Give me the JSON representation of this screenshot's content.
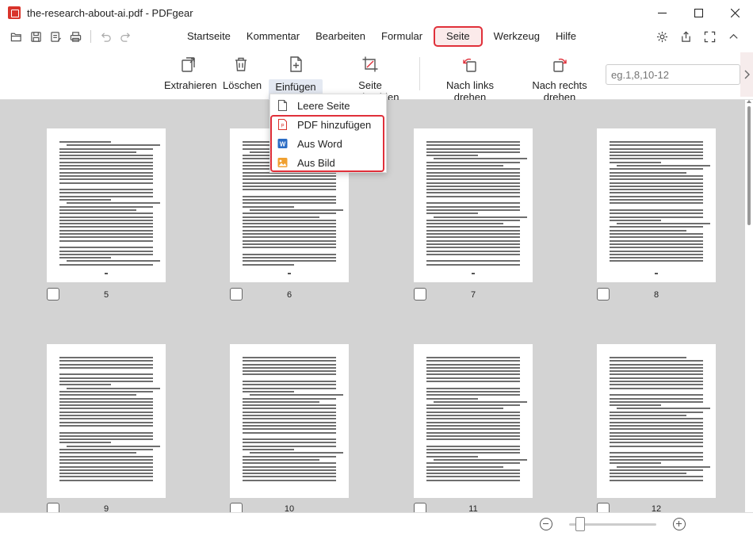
{
  "window": {
    "title": "the-research-about-ai.pdf - PDFgear"
  },
  "menu": {
    "items": [
      "Startseite",
      "Kommentar",
      "Bearbeiten",
      "Formular",
      "Seite",
      "Werkzeug",
      "Hilfe"
    ],
    "active": "Seite"
  },
  "toolbar": {
    "extract": "Extrahieren",
    "delete": "Löschen",
    "insert": "Einfügen",
    "crop": "Seite zuschneiden",
    "rotate_left": "Nach links drehen",
    "rotate_right": "Nach rechts drehen",
    "page_range_placeholder": "eg.1,8,10-12"
  },
  "insert_menu": {
    "blank": "Leere Seite",
    "add_pdf": "PDF hinzufügen",
    "from_word": "Aus Word",
    "from_image": "Aus Bild"
  },
  "pages": {
    "row1": [
      "5",
      "6",
      "7",
      "8"
    ],
    "row2": [
      "9",
      "10",
      "11",
      "12"
    ]
  },
  "colors": {
    "accent_red": "#e0303a",
    "content_bg": "#d3d3d3",
    "word_blue": "#2b6cc4",
    "image_orange": "#f0a030"
  },
  "icons": {
    "app": "pdfgear-logo-icon",
    "open": "folder-open-icon",
    "save": "save-icon",
    "save_as": "save-as-icon",
    "print": "print-icon",
    "undo": "undo-icon",
    "redo": "redo-icon",
    "settings": "gear-icon",
    "share": "share-icon",
    "fullscreen": "fullscreen-icon",
    "collapse": "collapse-icon"
  }
}
